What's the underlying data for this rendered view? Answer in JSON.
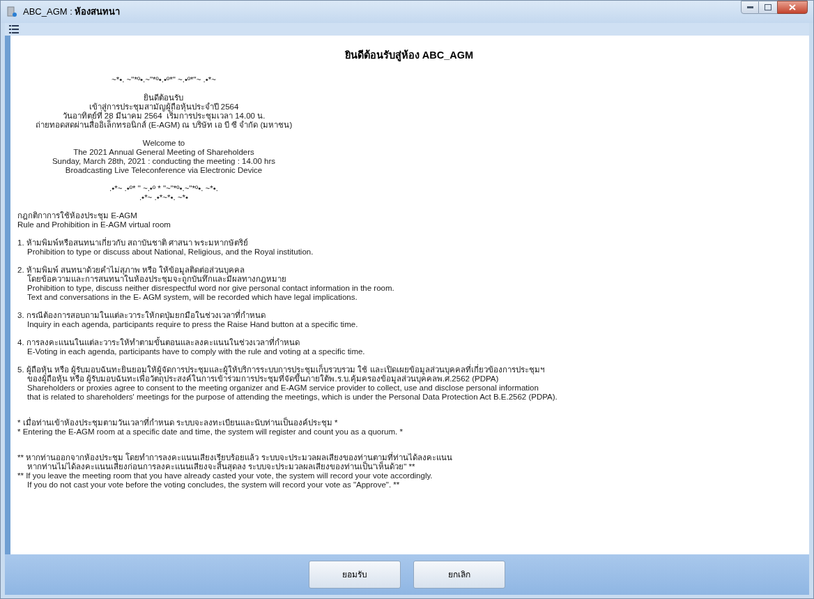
{
  "window": {
    "title_prefix": "ABC_AGM :",
    "title": "ห้องสนทนา"
  },
  "heading": "ยินดีต้อนรับสู่ห้อง ABC_AGM",
  "intro_groups": [
    {
      "lines": [
        "~*•. ~\"*º•.~\"*º•.•º*\" ~.•º*\"~ .•*~"
      ]
    },
    {
      "lines": [
        "ยินดีต้อนรับ",
        "เข้าสู่การประชุมสามัญผู้ถือหุ้นประจำปี 2564",
        "วันอาทิตย์ที่ 28 มีนาคม 2564  เริ่มการประชุมเวลา 14.00 น.",
        "ถ่ายทอดสดผ่านสื่ออิเล็กทรอนิกส์ (E-AGM) ณ บริษัท เอ บี ซี จำกัด (มหาชน)"
      ]
    },
    {
      "lines": [
        "Welcome to",
        "The 2021 Annual General Meeting of Shareholders",
        "Sunday, March 28th, 2021 : conducting the meeting : 14.00 hrs",
        "Broadcasting Live Teleconference via Electronic Device"
      ]
    },
    {
      "lines": [
        ".•*~ .•º* \" ~.•º * \"~\"*º•.~\"*º•. ~*•.",
        ".•*~ .•*~*•. ~*•"
      ]
    }
  ],
  "paragraphs": [
    {
      "lines": [
        {
          "text": "กฎกติกาการใช้ห้องประชุม E-AGM",
          "indent": false
        },
        {
          "text": "Rule and Prohibition in E-AGM virtual room",
          "indent": false
        }
      ]
    },
    {
      "lines": [
        {
          "text": "1. ห้ามพิมพ์หรือสนทนาเกี่ยวกับ สถาบันชาติ ศาสนา พระมหากษัตริย์",
          "indent": false
        },
        {
          "text": "Prohibition to type or discuss about National, Religious, and the Royal institution.",
          "indent": true
        }
      ]
    },
    {
      "lines": [
        {
          "text": "2. ห้ามพิมพ์ สนทนาด้วยคำไม่สุภาพ หรือ ให้ข้อมูลติดต่อส่วนบุคคล",
          "indent": false
        },
        {
          "text": "โดยข้อความและการสนทนาในห้องประชุมจะถูกบันทึกและมีผลทางกฎหมาย",
          "indent": true
        },
        {
          "text": "Prohibition to type, discuss neither disrespectful word nor give personal contact information in the room.",
          "indent": true
        },
        {
          "text": "Text and conversations in the E- AGM system, will be recorded which have legal implications.",
          "indent": true
        }
      ]
    },
    {
      "lines": [
        {
          "text": "3. กรณีต้องการสอบถามในแต่ละวาระให้กดปุ่มยกมือในช่วงเวลาที่กำหนด",
          "indent": false
        },
        {
          "text": "Inquiry in each agenda, participants require to press the Raise Hand button at a specific time.",
          "indent": true
        }
      ]
    },
    {
      "lines": [
        {
          "text": "4. การลงคะแนนในแต่ละวาระให้ทำตามขั้นตอนและลงคะแนนในช่วงเวลาที่กำหนด",
          "indent": false
        },
        {
          "text": "E-Voting in each agenda, participants have to comply with the rule and voting at a specific time.",
          "indent": true
        }
      ]
    },
    {
      "lines": [
        {
          "text": "5. ผู้ถือหุ้น หรือ ผู้รับมอบฉันทะยินยอมให้ผู้จัดการประชุมและผู้ให้บริการระบบการประชุมเก็บรวบรวม ใช้ และเปิดเผยข้อมูลส่วนบุคคลที่เกี่ยวข้องการประชุมฯ",
          "indent": false
        },
        {
          "text": "ของผู้ถือหุ้น หรือ ผู้รับมอบฉันทะเพื่อวัตถุประสงค์ในการเข้าร่วมการประชุมที่จัดขึ้นภายใต้พ.ร.บ.คุ้มครองข้อมูลส่วนบุคคลพ.ศ.2562 (PDPA)",
          "indent": true
        },
        {
          "text": "Shareholders or proxies agree to consent to the meeting organizer and E-AGM service provider to collect, use and disclose personal information",
          "indent": true
        },
        {
          "text": "that is related to shareholders' meetings for the purpose of attending the meetings, which is under the Personal Data Protection Act B.E.2562 (PDPA).",
          "indent": true
        }
      ]
    },
    {
      "lines": [
        {
          "text": "* เมื่อท่านเข้าห้องประชุมตามวันเวลาที่กำหนด ระบบจะลงทะเบียนและนับท่านเป็นองค์ประชุม *",
          "indent": false
        },
        {
          "text": "* Entering the E-AGM room at a specific date and time, the system will register and count you as a quorum. *",
          "indent": false
        }
      ]
    },
    {
      "lines": [
        {
          "text": "** หากท่านออกจากห้องประชุม โดยทำการลงคะแนนเสียงเรียบร้อยแล้ว ระบบจะประมวลผลเสียงของท่านตามที่ท่านได้ลงคะแนน",
          "indent": false
        },
        {
          "text": "หากท่านไม่ได้ลงคะแนนเสียงก่อนการลงคะแนนเสียงจะสิ้นสุดลง ระบบจะประมวลผลเสียงของท่านเป็น\"เห็นด้วย\" **",
          "indent": true
        },
        {
          "text": "** If you leave the meeting room that you have already casted your vote, the system will record your vote accordingly.",
          "indent": false
        },
        {
          "text": "If you do not cast your vote before the voting concludes, the system will record your vote as \"Approve\". **",
          "indent": true
        }
      ]
    }
  ],
  "buttons": [
    "ยอมรับ",
    "ยกเลิก"
  ]
}
